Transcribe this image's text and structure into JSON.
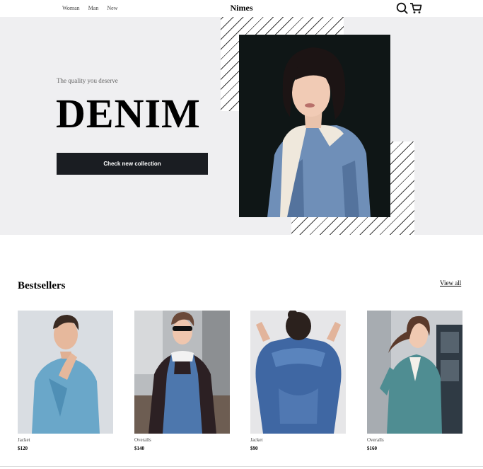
{
  "header": {
    "nav": [
      "Woman",
      "Man",
      "New"
    ],
    "brand": "Nimes",
    "icons": [
      "search-icon",
      "cart-icon"
    ]
  },
  "hero": {
    "tagline": "The quality you deserve",
    "headline": "DENIM",
    "cta_label": "Check new collection",
    "colors": {
      "background": "#efeff1",
      "button": "#1a1d22",
      "photo_bg": "#0f1616"
    }
  },
  "bestsellers": {
    "title": "Bestsellers",
    "view_all": "View all",
    "products": [
      {
        "name": "Jacket",
        "price": "$120"
      },
      {
        "name": "Overalls",
        "price": "$140"
      },
      {
        "name": "Jacket",
        "price": "$90"
      },
      {
        "name": "Overalls",
        "price": "$160"
      }
    ]
  }
}
